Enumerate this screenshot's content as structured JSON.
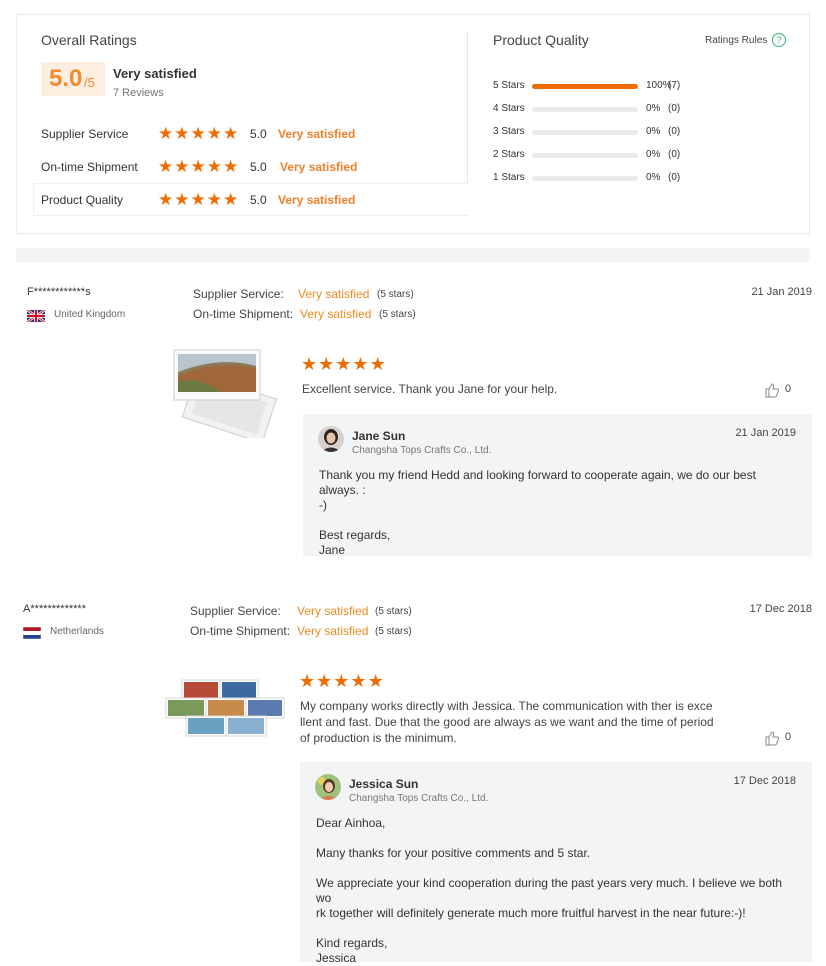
{
  "summary": {
    "overall_title": "Overall Ratings",
    "score": "5.0",
    "score_denominator": "/5",
    "score_label": "Very satisfied",
    "reviews_count": "7 Reviews",
    "rows": [
      {
        "label": "Supplier Service",
        "stars": 5,
        "value": "5.0",
        "verdict": "Very satisfied"
      },
      {
        "label": "On-time Shipment",
        "stars": 5,
        "value": "5.0",
        "verdict": "Very satisfied"
      },
      {
        "label": "Product Quality",
        "stars": 5,
        "value": "5.0",
        "verdict": "Very satisfied"
      }
    ],
    "pq_title": "Product Quality",
    "rules_label": "Ratings Rules",
    "rules_icon": "question-circle-icon",
    "distribution": [
      {
        "label": "5 Stars",
        "percent": "100%",
        "count": "(7)",
        "fraction": 1.0
      },
      {
        "label": "4 Stars",
        "percent": "0%",
        "count": "(0)",
        "fraction": 0
      },
      {
        "label": "3 Stars",
        "percent": "0%",
        "count": "(0)",
        "fraction": 0
      },
      {
        "label": "2 Stars",
        "percent": "0%",
        "count": "(0)",
        "fraction": 0
      },
      {
        "label": "1 Stars",
        "percent": "0%",
        "count": "(0)",
        "fraction": 0
      }
    ]
  },
  "reviews": [
    {
      "reviewer": "F************s",
      "country": "United Kingdom",
      "flag": "uk-flag",
      "service_label": "Supplier Service:",
      "service_value": "Very satisfied",
      "service_stars": "(5 stars)",
      "shipment_label": "On-time Shipment:",
      "shipment_value": "Very satisfied",
      "shipment_stars": "(5 stars)",
      "date": "21 Jan 2019",
      "rating": 5,
      "comment": "Excellent service. Thank you Jane for your help.",
      "likes": "0",
      "reply": {
        "name": "Jane Sun",
        "company": "Changsha Tops Crafts Co., Ltd.",
        "date": "21 Jan 2019",
        "paragraphs": [
          "Thank you my friend Hedd and looking forward to cooperate again, we do our best always. :\n-)",
          "Best regards,\nJane"
        ]
      }
    },
    {
      "reviewer": "A*************",
      "country": "Netherlands",
      "flag": "netherlands-flag",
      "service_label": "Supplier Service:",
      "service_value": "Very satisfied",
      "service_stars": "(5 stars)",
      "shipment_label": "On-time Shipment:",
      "shipment_value": "Very satisfied",
      "shipment_stars": "(5 stars)",
      "date": "17 Dec 2018",
      "rating": 5,
      "comment": "My company works directly with Jessica. The communication with ther is exce\nllent and fast. Due that the good are always as we want and the time of period\nof production is the minimum.",
      "likes": "0",
      "reply": {
        "name": "Jessica Sun",
        "company": "Changsha Tops Crafts Co., Ltd.",
        "date": "17 Dec 2018",
        "paragraphs": [
          "Dear Ainhoa,",
          "Many thanks for your positive comments and 5 star.",
          "We appreciate your kind cooperation during the past years very much. I believe we both wo\nrk together will definitely generate much more fruitful harvest in the near future:-)!",
          "Kind regards,\nJessica"
        ]
      }
    }
  ],
  "icons": {
    "star": "star-icon",
    "like": "thumbs-up-icon"
  },
  "colors": {
    "accent": "#ef6c00",
    "accent_text": "#f08a1e",
    "score_bg": "#fdeee2",
    "reply_bg": "#f3f4f6"
  }
}
